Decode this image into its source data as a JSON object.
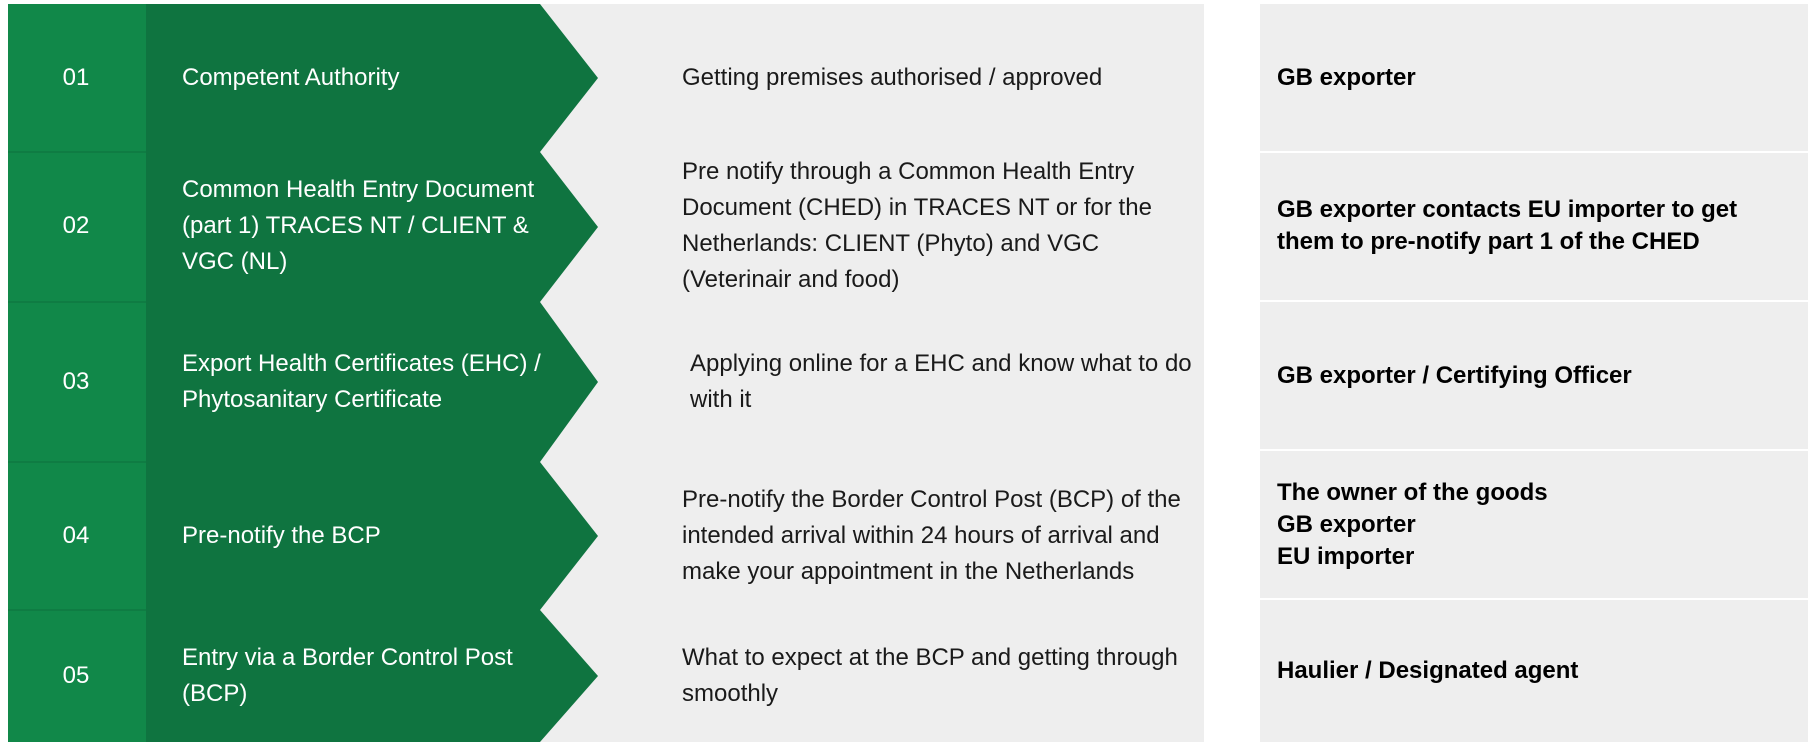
{
  "colors": {
    "tab_green": "#118849",
    "arrow_green": "#0f7440",
    "panel_grey": "#eeeeee",
    "divider": "#ffffff"
  },
  "steps": [
    {
      "number": "01",
      "title": "Competent Authority",
      "description": "Getting premises authorised / approved",
      "responsible": "GB exporter"
    },
    {
      "number": "02",
      "title": "Common Health Entry Document (part 1) TRACES NT / CLIENT & VGC (NL)",
      "description": "Pre notify through a Common Health Entry Document (CHED) in TRACES NT or for the Netherlands: CLIENT (Phyto) and VGC (Veterinair and food)",
      "responsible": "GB exporter contacts EU importer to get them to pre-notify part 1 of the CHED"
    },
    {
      "number": "03",
      "title": "Export Health Certificates (EHC) / Phytosanitary Certificate",
      "description": "Applying online for a EHC and know what to do with it",
      "responsible": "GB exporter / Certifying Officer"
    },
    {
      "number": "04",
      "title": "Pre-notify the BCP",
      "description": "Pre-notify the Border Control Post (BCP)  of the intended arrival within 24 hours of arrival and make your appointment in the Netherlands",
      "responsible": "The owner of the goods\nGB exporter\nEU importer"
    },
    {
      "number": "05",
      "title": "Entry via a Border Control Post (BCP)",
      "description": "What to expect at the BCP and getting through smoothly",
      "responsible": "Haulier / Designated agent"
    }
  ]
}
